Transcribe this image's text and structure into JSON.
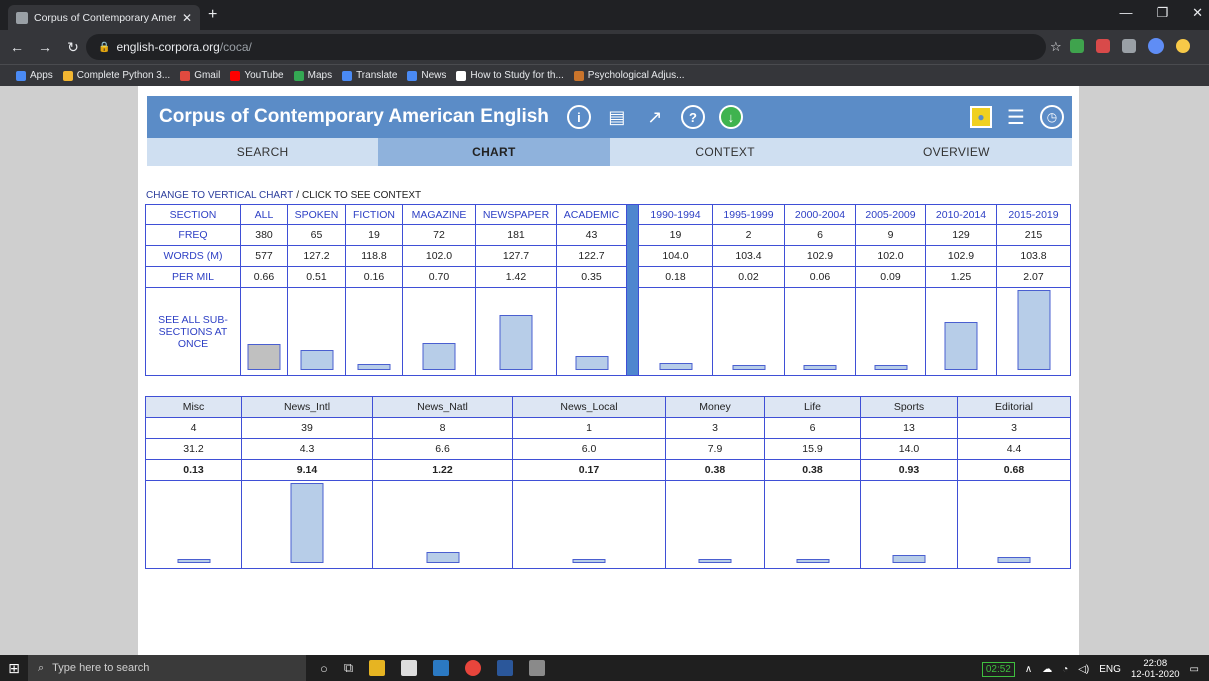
{
  "browser": {
    "tab_title": "Corpus of Contemporary Americ",
    "url_host": "english-corpora.org",
    "url_path": "/coca/",
    "bookmarks": [
      "Apps",
      "Complete Python 3...",
      "Gmail",
      "YouTube",
      "Maps",
      "Translate",
      "News",
      "How to Study for th...",
      "Psychological Adjus..."
    ]
  },
  "site": {
    "title": "Corpus of Contemporary American English",
    "tabs": [
      "SEARCH",
      "CHART",
      "CONTEXT",
      "OVERVIEW"
    ],
    "active_tab": "CHART",
    "crumb_change": "CHANGE TO VERTICAL CHART",
    "crumb_sep": "/",
    "crumb_context": "CLICK TO SEE CONTEXT"
  },
  "table1": {
    "headers": [
      "SECTION",
      "ALL",
      "SPOKEN",
      "FICTION",
      "MAGAZINE",
      "NEWSPAPER",
      "ACADEMIC",
      "1990-1994",
      "1995-1999",
      "2000-2004",
      "2005-2009",
      "2010-2014",
      "2015-2019"
    ],
    "freq_label": "FREQ",
    "freq": [
      "380",
      "65",
      "19",
      "72",
      "181",
      "43",
      "19",
      "2",
      "6",
      "9",
      "129",
      "215"
    ],
    "words_label": "WORDS (M)",
    "words": [
      "577",
      "127.2",
      "118.8",
      "102.0",
      "127.7",
      "122.7",
      "104.0",
      "103.4",
      "102.9",
      "102.0",
      "102.9",
      "103.8"
    ],
    "permil_label": "PER MIL",
    "permil": [
      "0.66",
      "0.51",
      "0.16",
      "0.70",
      "1.42",
      "0.35",
      "0.18",
      "0.02",
      "0.06",
      "0.09",
      "1.25",
      "2.07"
    ],
    "see_all": "SEE ALL SUB-SECTIONS AT ONCE"
  },
  "table2": {
    "headers": [
      "Misc",
      "News_Intl",
      "News_Natl",
      "News_Local",
      "Money",
      "Life",
      "Sports",
      "Editorial"
    ],
    "freq": [
      "4",
      "39",
      "8",
      "1",
      "3",
      "6",
      "13",
      "3"
    ],
    "words": [
      "31.2",
      "4.3",
      "6.6",
      "6.0",
      "7.9",
      "15.9",
      "14.0",
      "4.4"
    ],
    "permil": [
      "0.13",
      "9.14",
      "1.22",
      "0.17",
      "0.38",
      "0.38",
      "0.93",
      "0.68"
    ]
  },
  "taskbar": {
    "search_placeholder": "Type here to search",
    "battery": "02:52",
    "lang": "ENG",
    "time": "22:08",
    "date": "12-01-2020"
  }
}
